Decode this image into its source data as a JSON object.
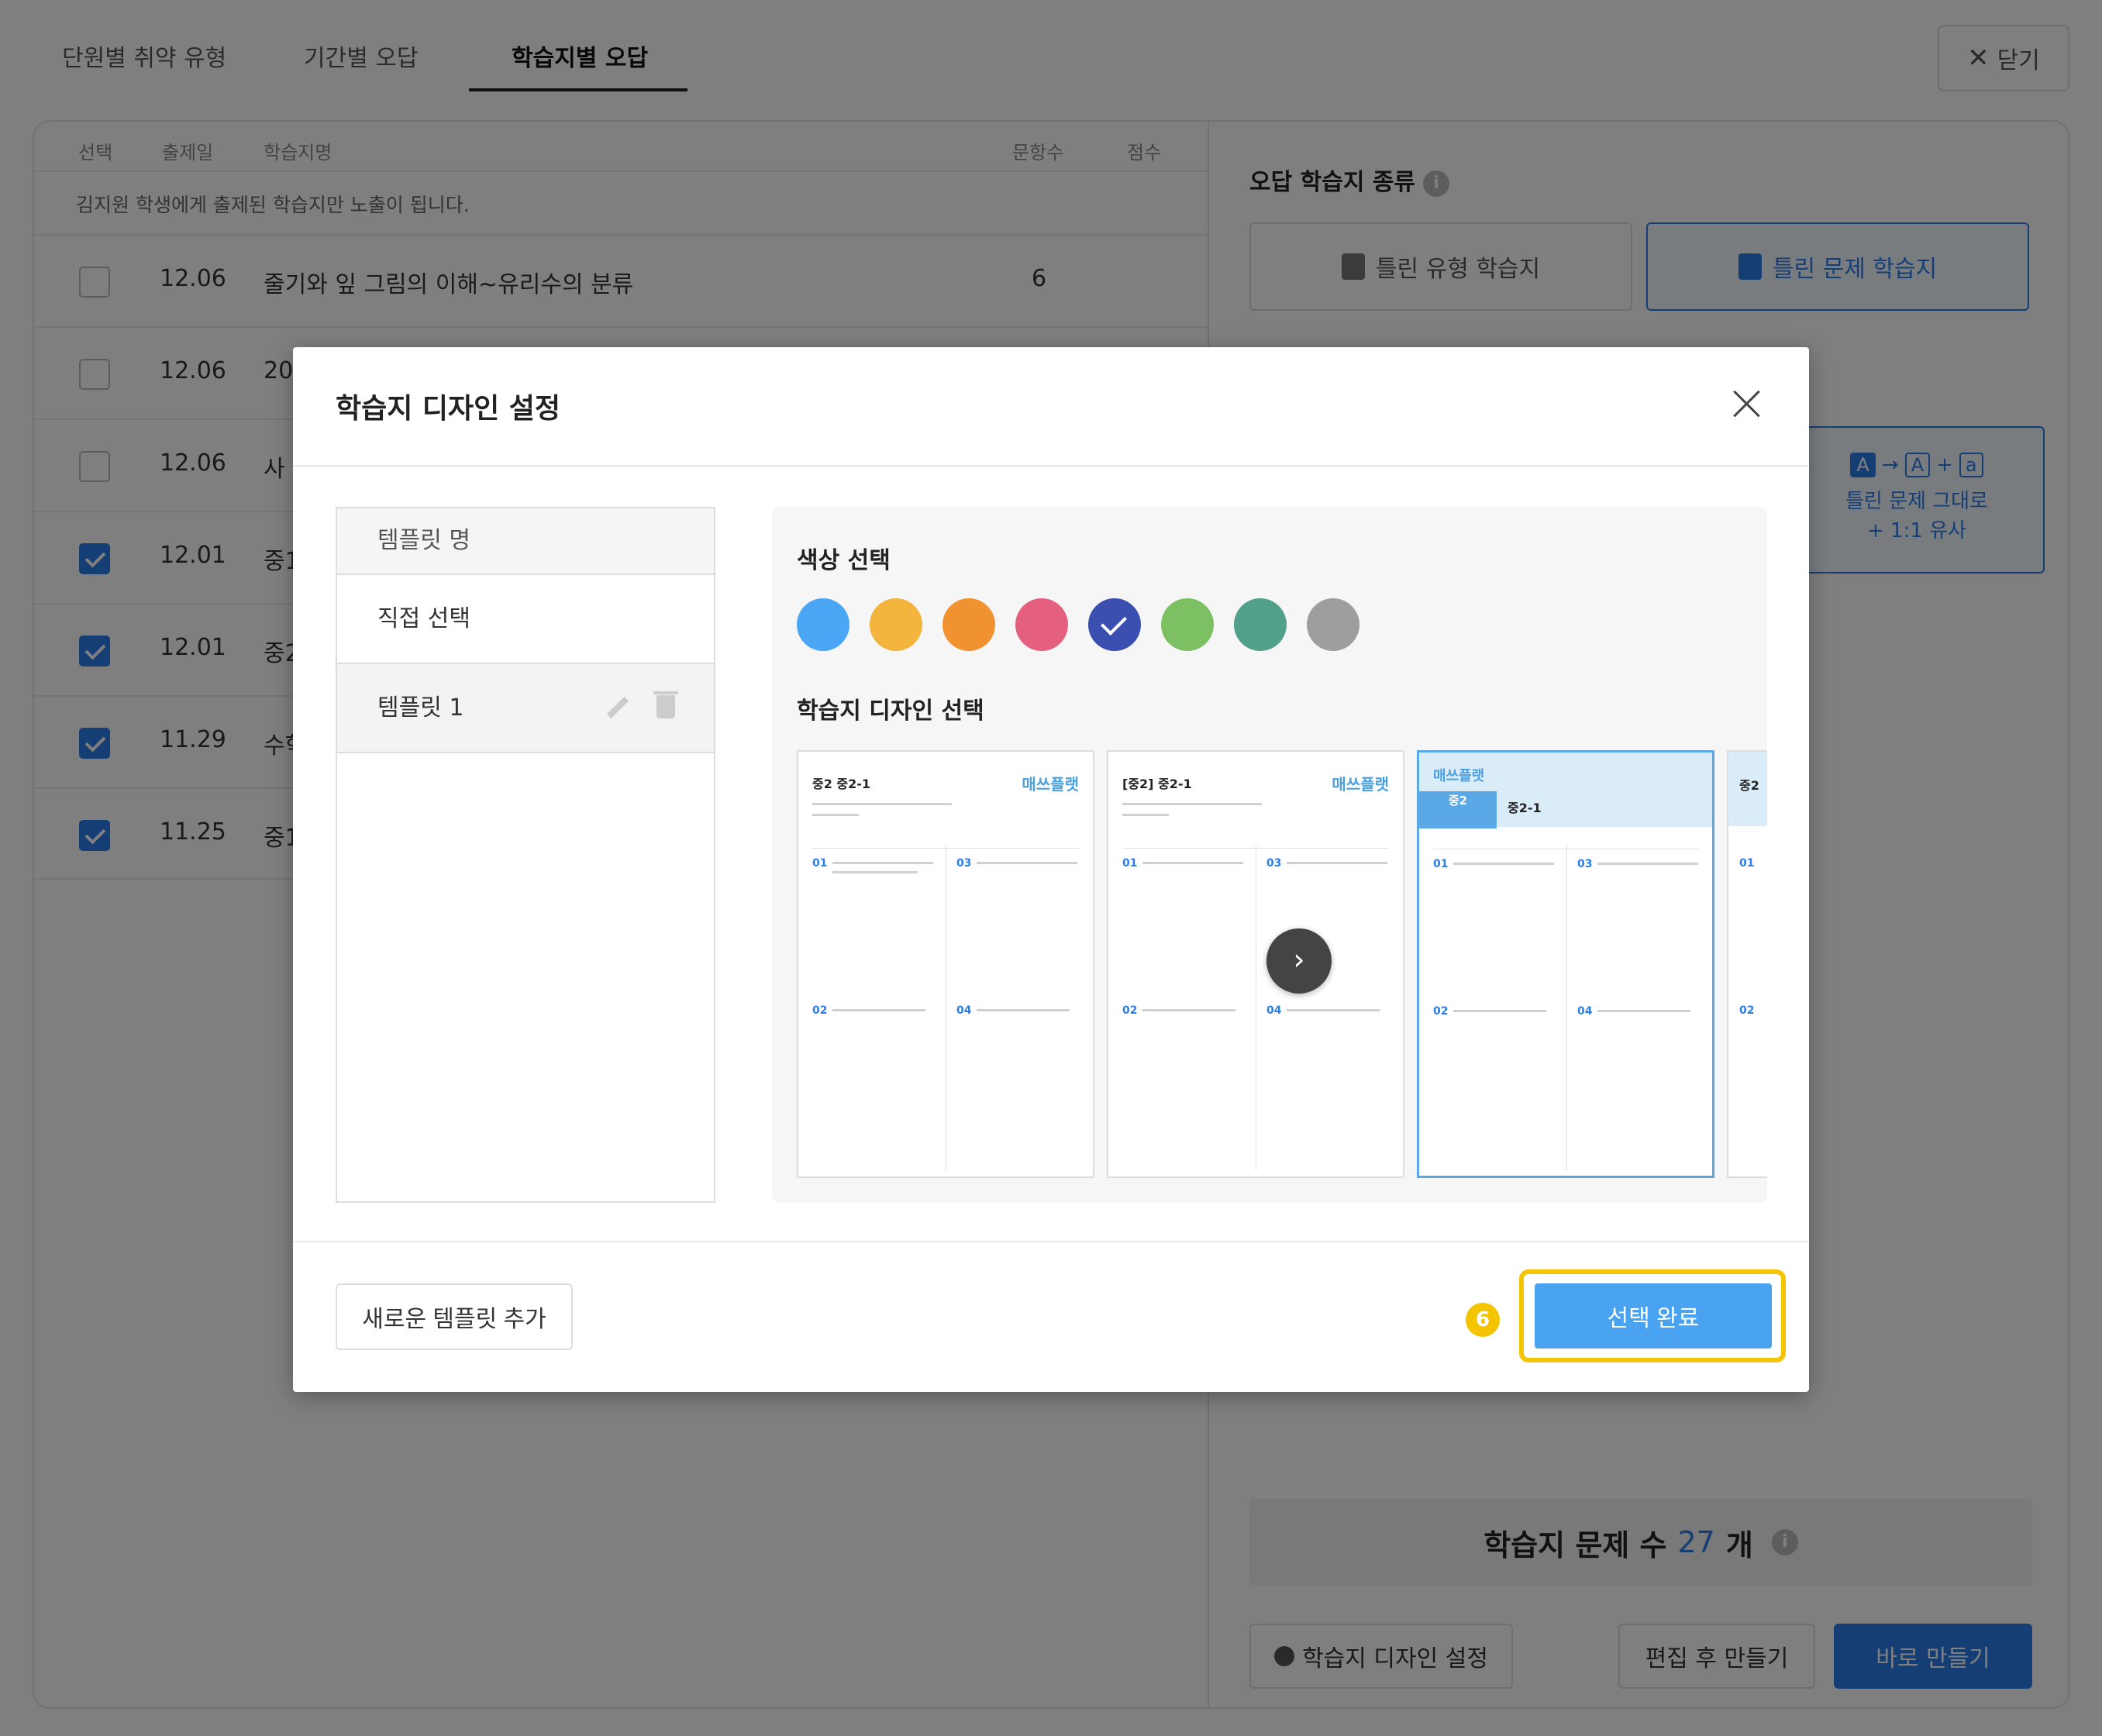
{
  "tabs": [
    "단원별 취약 유형",
    "기간별 오답",
    "학습지별 오답"
  ],
  "close_button": "닫기",
  "table": {
    "headers": [
      "선택",
      "출제일",
      "학습지명",
      "문항수",
      "점수"
    ],
    "notice": "김지원 학생에게 출제된 학습지만 노출이 됩니다.",
    "rows": [
      {
        "checked": false,
        "date": "12.06",
        "name": "줄기와 잎 그림의 이해~유리수의 분류",
        "count": "6"
      },
      {
        "checked": false,
        "date": "12.06",
        "name": "20",
        "count": ""
      },
      {
        "checked": false,
        "date": "12.06",
        "name": "사",
        "count": ""
      },
      {
        "checked": true,
        "date": "12.01",
        "name": "중1",
        "count": ""
      },
      {
        "checked": true,
        "date": "12.01",
        "name": "중2",
        "count": ""
      },
      {
        "checked": true,
        "date": "11.29",
        "name": "수학",
        "count": ""
      },
      {
        "checked": true,
        "date": "11.25",
        "name": "중1",
        "count": ""
      }
    ]
  },
  "right_panel": {
    "title": "오답 학습지 종류",
    "type_buttons": [
      "틀린 유형 학습지",
      "틀린 문제 학습지"
    ],
    "option_card": {
      "line1": "틀린 문제 그대로",
      "line2": "+ 1:1 유사"
    },
    "count_label": "학습지 문제 수",
    "count_value": "27",
    "count_unit": "개",
    "buttons": {
      "design": "학습지 디자인 설정",
      "edit": "편집 후 만들기",
      "create": "바로 만들기"
    }
  },
  "modal": {
    "title": "학습지 디자인 설정",
    "template_header": "템플릿 명",
    "templates": [
      "직접 선택",
      "템플릿 1"
    ],
    "color_section_title": "색상 선택",
    "colors": [
      "#4ba6f5",
      "#f4b53f",
      "#f0922f",
      "#e4607e",
      "#3a4fb0",
      "#7cc063",
      "#51a08c",
      "#9e9e9e"
    ],
    "selected_color_index": 4,
    "design_section_title": "학습지 디자인 선택",
    "thumbnails": [
      {
        "head": "중2 중2-1",
        "brand": "매쓰플랫"
      },
      {
        "head": "[중2] 중2-1",
        "brand": "매쓰플랫"
      },
      {
        "head": "중2-1",
        "brand": "매쓰플랫"
      },
      {
        "head": "중2",
        "brand": ""
      }
    ],
    "add_template_button": "새로운 템플릿 추가",
    "complete_button": "선택 완료",
    "step_number": "6"
  }
}
